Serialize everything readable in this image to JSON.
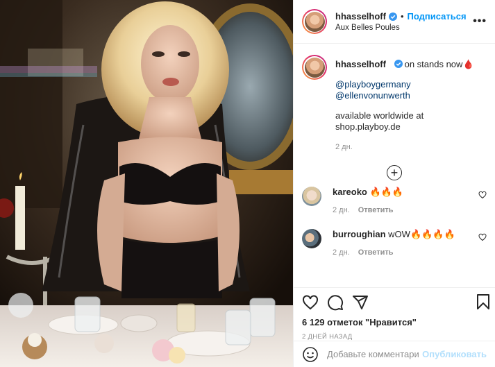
{
  "header": {
    "username": "hhasselhoff",
    "separator": "•",
    "follow_label": "Подписаться",
    "location": "Aux Belles Poules",
    "more_label": "•••"
  },
  "caption": {
    "username": "hhasselhoff",
    "text": "on stands now",
    "emoji": "🩸",
    "mentions": "@playboygermany @ellenvonunwerth",
    "line3": "available worldwide at",
    "line4": "shop.playboy.de",
    "time": "2 дн."
  },
  "load_more_label": "+",
  "comments": [
    {
      "username": "kareoko",
      "text": "🔥🔥🔥",
      "time": "2 дн.",
      "reply_label": "Ответить"
    },
    {
      "username": "burroughian",
      "text": "wOW🔥🔥🔥🔥",
      "time": "2 дн.",
      "reply_label": "Ответить"
    }
  ],
  "likes_text": "6 129 отметок \"Нравится\"",
  "post_time": "2 ДНЕЙ НАЗАД",
  "add_comment": {
    "placeholder": "Добавьте комментарий...",
    "publish_label": "Опубликовать"
  },
  "icons": [
    "verified-icon",
    "more-icon",
    "like-icon",
    "comment-icon",
    "share-icon",
    "bookmark-icon",
    "emoji-icon",
    "add-icon",
    "heart-small-icon"
  ],
  "colors": {
    "accent": "#0095f6",
    "publish_disabled": "#b2dffc",
    "text": "#262626",
    "muted": "#8e8e8e",
    "border": "#efefef"
  }
}
